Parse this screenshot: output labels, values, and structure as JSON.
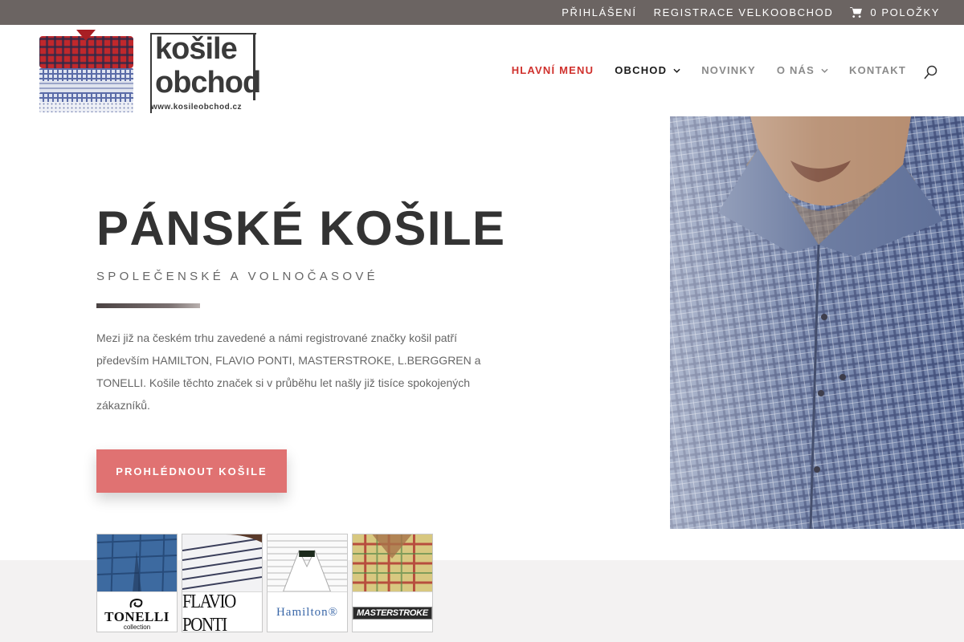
{
  "topbar": {
    "login": "PŘIHLÁŠENÍ",
    "register": "REGISTRACE VELKOOBCHOD",
    "cart": "0 POLOŽKY"
  },
  "logo": {
    "line1": "košile",
    "line2": "obchod",
    "url": "www.kosileobchod.cz"
  },
  "nav": {
    "items": [
      {
        "label": "HLAVNÍ MENU"
      },
      {
        "label": "OBCHOD"
      },
      {
        "label": "NOVINKY"
      },
      {
        "label": "O NÁS"
      },
      {
        "label": "KONTAKT"
      }
    ]
  },
  "hero": {
    "title": "PÁNSKÉ KOŠILE",
    "subtitle": "SPOLEČENSKÉ A VOLNOČASOVÉ",
    "body": "Mezi již na českém trhu zavedené a námi registrované značky košil patří především HAMILTON, FLAVIO PONTI, MASTERSTROKE, L.BERGGREN a TONELLI. Košile těchto značek si v průběhu let našly již tisíce spokojených zákazníků.",
    "cta": "PROHLÉDNOUT KOŠILE"
  },
  "brands": {
    "tonelli": {
      "name": "TONELLI",
      "sub": "collection"
    },
    "flavio": {
      "name": "FLAVIO PONTI"
    },
    "hamilton": {
      "name": "Hamilton®"
    },
    "masterstroke": {
      "name": "MASTERSTROKE"
    }
  },
  "colors": {
    "topbar": "#6b6462",
    "accent_red": "#d0312d",
    "cta": "#e07272"
  }
}
